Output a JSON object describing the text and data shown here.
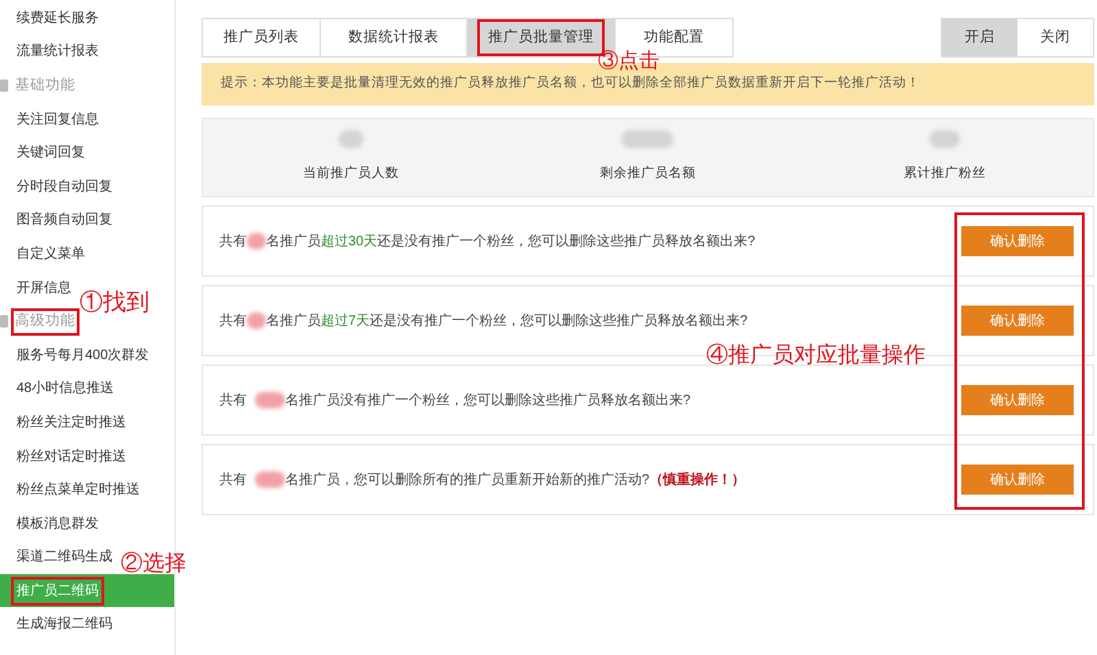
{
  "sidebar": {
    "items": [
      {
        "kind": "item",
        "label": "续费延长服务",
        "selected": false,
        "annotated": false
      },
      {
        "kind": "item",
        "label": "流量统计报表",
        "selected": false,
        "annotated": false
      },
      {
        "kind": "header",
        "label": "基础功能",
        "annotated": false
      },
      {
        "kind": "item",
        "label": "关注回复信息",
        "selected": false,
        "annotated": false
      },
      {
        "kind": "item",
        "label": "关键词回复",
        "selected": false,
        "annotated": false
      },
      {
        "kind": "item",
        "label": "分时段自动回复",
        "selected": false,
        "annotated": false
      },
      {
        "kind": "item",
        "label": "图音频自动回复",
        "selected": false,
        "annotated": false
      },
      {
        "kind": "item",
        "label": "自定义菜单",
        "selected": false,
        "annotated": false
      },
      {
        "kind": "item",
        "label": "开屏信息",
        "selected": false,
        "annotated": false
      },
      {
        "kind": "header",
        "label": "高级功能",
        "annotated": true
      },
      {
        "kind": "item",
        "label": "服务号每月400次群发",
        "selected": false,
        "annotated": false
      },
      {
        "kind": "item",
        "label": "48小时信息推送",
        "selected": false,
        "annotated": false
      },
      {
        "kind": "item",
        "label": "粉丝关注定时推送",
        "selected": false,
        "annotated": false
      },
      {
        "kind": "item",
        "label": "粉丝对话定时推送",
        "selected": false,
        "annotated": false
      },
      {
        "kind": "item",
        "label": "粉丝点菜单定时推送",
        "selected": false,
        "annotated": false
      },
      {
        "kind": "item",
        "label": "模板消息群发",
        "selected": false,
        "annotated": false
      },
      {
        "kind": "item",
        "label": "渠道二维码生成",
        "selected": false,
        "annotated": false
      },
      {
        "kind": "item",
        "label": "推广员二维码",
        "selected": true,
        "annotated": true
      },
      {
        "kind": "item",
        "label": "生成海报二维码",
        "selected": false,
        "annotated": false
      }
    ]
  },
  "tabs": [
    {
      "label": "推广员列表",
      "selected": false,
      "annotated": false
    },
    {
      "label": "数据统计报表",
      "selected": false,
      "annotated": false
    },
    {
      "label": "推广员批量管理",
      "selected": true,
      "annotated": true
    },
    {
      "label": "功能配置",
      "selected": false,
      "annotated": false
    }
  ],
  "toggle": [
    {
      "label": "开启",
      "selected": true
    },
    {
      "label": "关闭",
      "selected": false
    }
  ],
  "notice": "提示：本功能主要是批量清理无效的推广员释放推广员名额，也可以删除全部推广员数据重新开启下一轮推广活动！",
  "stats": [
    {
      "label": "当前推广员人数"
    },
    {
      "label": "剩余推广员名额"
    },
    {
      "label": "累计推广粉丝"
    }
  ],
  "actions": {
    "annotated": true,
    "rows": [
      {
        "prefix": "共有",
        "segments": [
          {
            "kind": "normal",
            "text": "名推广员"
          },
          {
            "kind": "highlight",
            "text": "超过30天"
          },
          {
            "kind": "normal",
            "text": "还是没有推广一个粉丝，您可以删除这些推广员释放名额出来?"
          }
        ],
        "button": "确认删除"
      },
      {
        "prefix": "共有",
        "segments": [
          {
            "kind": "normal",
            "text": "名推广员"
          },
          {
            "kind": "highlight",
            "text": "超过7天"
          },
          {
            "kind": "normal",
            "text": "还是没有推广一个粉丝，您可以删除这些推广员释放名额出来?"
          }
        ],
        "button": "确认删除"
      },
      {
        "prefix": "共有",
        "segments": [
          {
            "kind": "normal",
            "text": "名推广员没有推广一个粉丝，您可以删除这些推广员释放名额出来?"
          }
        ],
        "button": "确认删除"
      },
      {
        "prefix": "共有",
        "segments": [
          {
            "kind": "normal",
            "text": "名推广员，您可以删除所有的推广员重新开始新的推广活动?"
          },
          {
            "kind": "warning",
            "text": "（慎重操作！）"
          }
        ],
        "button": "确认删除"
      }
    ]
  },
  "annotations": [
    "①找到",
    "②选择",
    "③点击",
    "④推广员对应批量操作"
  ]
}
